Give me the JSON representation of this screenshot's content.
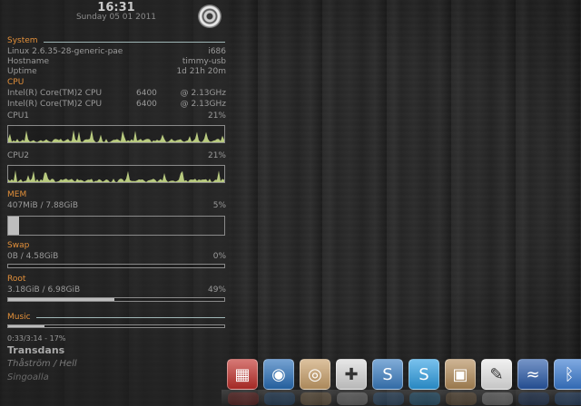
{
  "clock": {
    "time": "16:31",
    "date": "Sunday 05 01 2011"
  },
  "system": {
    "header": "System",
    "kernel": "Linux 2.6.35-28-generic-pae",
    "arch": "i686",
    "hostname_label": "Hostname",
    "hostname": "timmy-usb",
    "uptime_label": "Uptime",
    "uptime": "1d 21h 20m"
  },
  "cpu": {
    "header": "CPU",
    "lines": [
      {
        "model": "Intel(R) Core(TM)2 CPU",
        "num": "6400",
        "freq": "@ 2.13GHz"
      },
      {
        "model": "Intel(R) Core(TM)2 CPU",
        "num": "6400",
        "freq": "@ 2.13GHz"
      }
    ],
    "cpu1_label": "CPU1",
    "cpu1_pct": "21%",
    "cpu2_label": "CPU2",
    "cpu2_pct": "21%"
  },
  "mem": {
    "header": "MEM",
    "usage": "407MiB / 7.88GiB",
    "pct": "5%",
    "fill": 0.05
  },
  "swap": {
    "header": "Swap",
    "usage": "0B   / 4.58GiB",
    "pct": "0%",
    "fill": 0.0
  },
  "root": {
    "header": "Root",
    "usage": "3.18GiB / 6.98GiB",
    "pct": "49%",
    "fill": 0.49
  },
  "music": {
    "header": "Music",
    "progress_text": "0:33/3:14 - 17%",
    "fill": 0.17,
    "title": "Transdans",
    "artist": "Thåström / Hell",
    "album": "Singoalla"
  },
  "dock": {
    "items": [
      {
        "name": "dock-app-red-grid-icon",
        "bg": "#c0302b",
        "glyph": "▦"
      },
      {
        "name": "dock-firefox-icon",
        "bg": "#2a6fb8",
        "glyph": "◉"
      },
      {
        "name": "dock-speaker-icon",
        "bg": "#c9a06a",
        "glyph": "◎"
      },
      {
        "name": "dock-gamepad-icon",
        "bg": "#d8d8d8",
        "glyph": "✚"
      },
      {
        "name": "dock-skype-s-icon",
        "bg": "#3b7ec2",
        "glyph": "S"
      },
      {
        "name": "dock-skype-icon",
        "bg": "#2f9fe3",
        "glyph": "S"
      },
      {
        "name": "dock-package-icon",
        "bg": "#b38c5a",
        "glyph": "▣"
      },
      {
        "name": "dock-notepad-icon",
        "bg": "#e8e8e8",
        "glyph": "✎"
      },
      {
        "name": "dock-wave-icon",
        "bg": "#2a5aa8",
        "glyph": "≈"
      },
      {
        "name": "dock-bluetooth-icon",
        "bg": "#3a7bd1",
        "glyph": "ᛒ"
      }
    ]
  }
}
